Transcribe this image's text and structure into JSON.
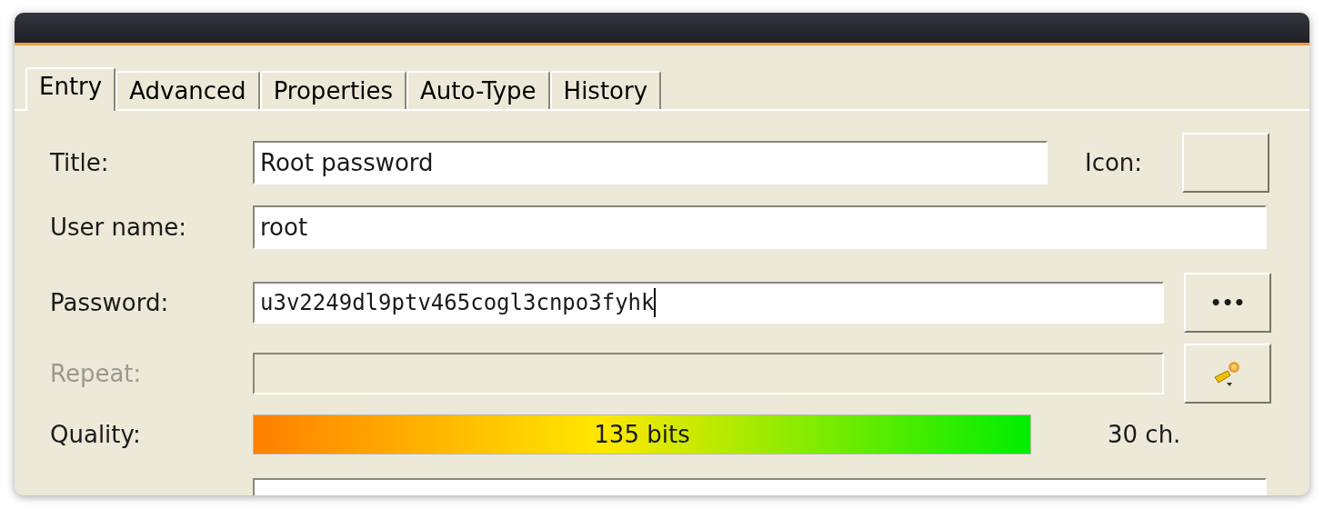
{
  "tabs": [
    {
      "label": "Entry",
      "selected": true
    },
    {
      "label": "Advanced",
      "selected": false
    },
    {
      "label": "Properties",
      "selected": false
    },
    {
      "label": "Auto-Type",
      "selected": false
    },
    {
      "label": "History",
      "selected": false
    }
  ],
  "fields": {
    "title": {
      "label": "Title:",
      "value": "Root password"
    },
    "icon": {
      "label": "Icon:"
    },
    "user_name": {
      "label": "User name:",
      "value": "root"
    },
    "password": {
      "label": "Password:",
      "value": "u3v2249dl9ptv465cogl3cnpo3fyhk"
    },
    "repeat": {
      "label": "Repeat:",
      "disabled": true
    },
    "quality": {
      "label": "Quality:",
      "level": 1,
      "reading": "135 bits",
      "length": "30 ch."
    }
  },
  "show_password_button": "•••"
}
